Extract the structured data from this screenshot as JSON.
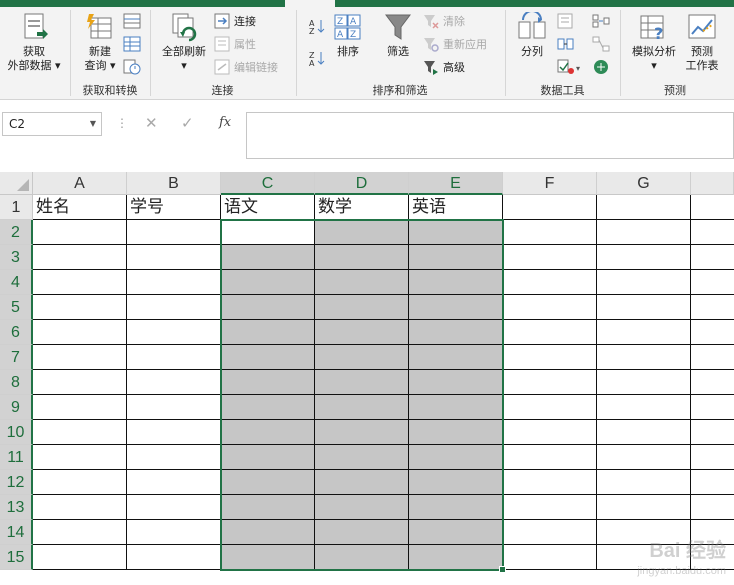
{
  "ribbon": {
    "groups": {
      "get_transform": "获取和转换",
      "connections": "连接",
      "sort_filter": "排序和筛选",
      "data_tools": "数据工具",
      "forecast": "预测"
    },
    "get_external_data": {
      "line1": "获取",
      "line2": "外部数据 ▾"
    },
    "new_query": {
      "line1": "新建",
      "line2": "查询 ▾"
    },
    "refresh_all": {
      "line1": "全部刷新",
      "line2": "▾"
    },
    "connections_btn": "连接",
    "properties_btn": "属性",
    "edit_links_btn": "编辑链接",
    "sort_btn": "排序",
    "filter_btn": "筛选",
    "clear_btn": "清除",
    "reapply_btn": "重新应用",
    "advanced_btn": "高级",
    "text_to_columns_btn": "分列",
    "whatif_btn": {
      "line1": "模拟分析",
      "line2": "▾"
    },
    "forecast_sheet_btn": {
      "line1": "预测",
      "line2": "工作表"
    }
  },
  "formula_bar": {
    "name_box": "C2",
    "fx_label": "fx",
    "formula_value": ""
  },
  "sheet": {
    "columns": [
      "A",
      "B",
      "C",
      "D",
      "E",
      "F",
      "G"
    ],
    "selected_columns": [
      "C",
      "D",
      "E"
    ],
    "rows": [
      "1",
      "2",
      "3",
      "4",
      "5",
      "6",
      "7",
      "8",
      "9",
      "10",
      "11",
      "12",
      "13",
      "14",
      "15"
    ],
    "selected_rows": [
      "2",
      "3",
      "4",
      "5",
      "6",
      "7",
      "8",
      "9",
      "10",
      "11",
      "12",
      "13",
      "14",
      "15"
    ],
    "header_row": [
      "姓名",
      "学号",
      "语文",
      "数学",
      "英语",
      "",
      ""
    ],
    "active_cell": "C2",
    "selection_range": "C2:E15",
    "shaded_fill_color": "#c6c6c6"
  },
  "watermark": {
    "main": "Bai 经验",
    "sub": "jingyan.baidu.com"
  },
  "colors": {
    "accent": "#217346",
    "ribbon_bg": "#f3f3f3",
    "header_bg": "#e9e9e9"
  }
}
